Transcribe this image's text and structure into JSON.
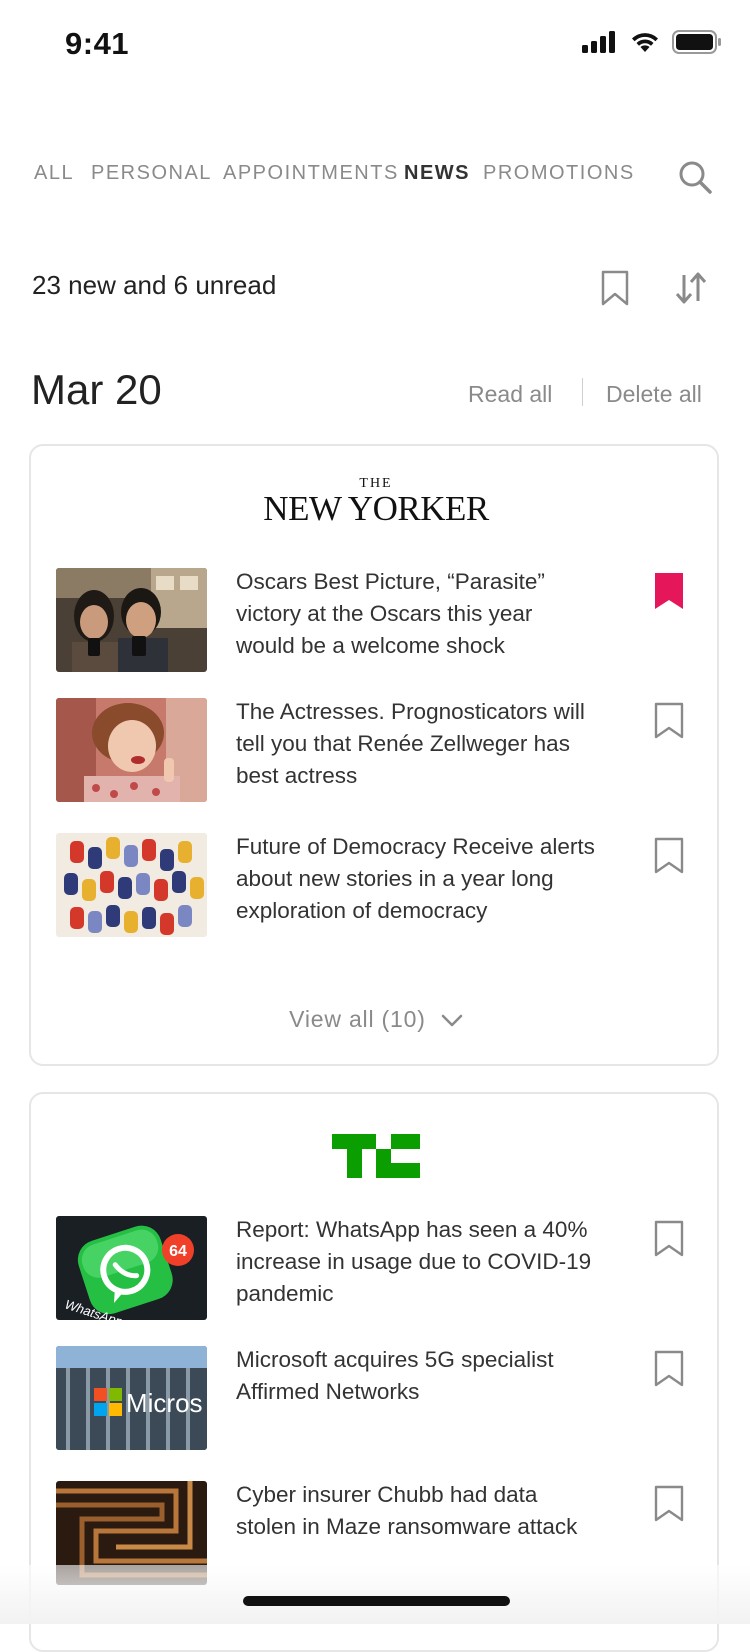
{
  "status": {
    "time": "9:41"
  },
  "tabs": [
    {
      "label": "ALL"
    },
    {
      "label": "PERSONAL"
    },
    {
      "label": "APPOINTMENTS"
    },
    {
      "label": "NEWS",
      "active": true
    },
    {
      "label": "PROMOTIONS"
    }
  ],
  "summary": {
    "text": "23 new and 6 unread"
  },
  "day": {
    "date": "Mar 20",
    "read_all": "Read all",
    "delete_all": "Delete all"
  },
  "sources": [
    {
      "logo_the": "THE",
      "logo_main": "NEW YORKER",
      "articles": [
        {
          "headline": "Oscars Best Picture, “Parasite” victory at the Oscars this year would be a welcome shock",
          "bookmarked": true
        },
        {
          "headline": "The Actresses. Prognosticators will tell you that Renée Zellweger has best actress",
          "bookmarked": false
        },
        {
          "headline": "Future of Democracy Receive alerts about new stories in a year long exploration of democracy",
          "bookmarked": false
        }
      ],
      "view_all": "View all (10)"
    },
    {
      "logo": "TC",
      "articles": [
        {
          "headline": "Report: WhatsApp has seen a 40% increase in usage due to COVID-19 pandemic",
          "bookmarked": false,
          "thumb_badge": "64",
          "thumb_text": "WhatsApp"
        },
        {
          "headline": "Microsoft acquires 5G specialist Affirmed Networks",
          "bookmarked": false,
          "thumb_text": "Micros"
        },
        {
          "headline": "Cyber insurer Chubb had data stolen in Maze ransomware attack",
          "bookmarked": false
        }
      ]
    }
  ],
  "colors": {
    "accent": "#e5175a",
    "tc_green": "#0a9e01",
    "muted": "#8a8a8a",
    "border": "#e6e6e6"
  }
}
